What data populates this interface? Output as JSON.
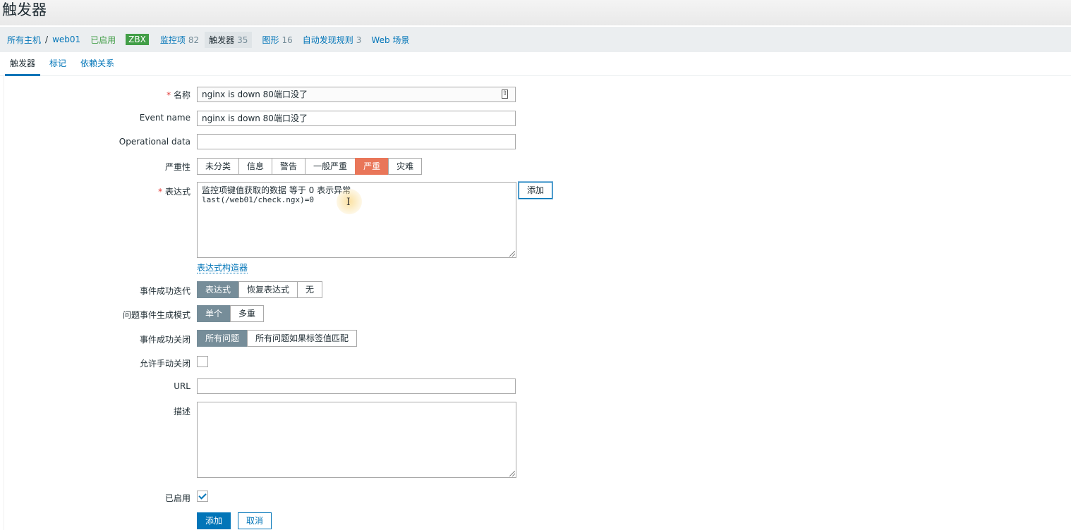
{
  "page": {
    "title": "触发器"
  },
  "breadcrumb": {
    "all_hosts": "所有主机",
    "separator": "/",
    "host": "web01",
    "status": "已启用",
    "zbx_badge": "ZBX",
    "items_label": "监控项",
    "items_count": "82",
    "triggers_label": "触发器",
    "triggers_count": "35",
    "graphs_label": "图形",
    "graphs_count": "16",
    "discovery_label": "自动发现规则",
    "discovery_count": "3",
    "web_label": "Web 场景"
  },
  "tabs": {
    "trigger": "触发器",
    "tags": "标记",
    "dependencies": "依赖关系"
  },
  "form": {
    "name_label": "名称",
    "name_value": "nginx is down 80端口没了",
    "event_name_label": "Event name",
    "event_name_value": "nginx is down 80端口没了",
    "opdata_label": "Operational data",
    "opdata_value": "",
    "severity_label": "严重性",
    "severity_options": [
      "未分类",
      "信息",
      "警告",
      "一般严重",
      "严重",
      "灾难"
    ],
    "severity_selected": "严重",
    "expression_label": "表达式",
    "expression_comment": "监控项键值获取的数据 等于 0 表示异常",
    "expression_code": "last(/web01/check.ngx)=0",
    "expression_add": "添加",
    "expression_builder": "表达式构造器",
    "ok_event_label": "事件成功迭代",
    "ok_event_options": [
      "表达式",
      "恢复表达式",
      "无"
    ],
    "ok_event_selected": "表达式",
    "problem_mode_label": "问题事件生成模式",
    "problem_mode_options": [
      "单个",
      "多重"
    ],
    "problem_mode_selected": "单个",
    "ok_close_label": "事件成功关闭",
    "ok_close_options": [
      "所有问题",
      "所有问题如果标签值匹配"
    ],
    "ok_close_selected": "所有问题",
    "manual_close_label": "允许手动关闭",
    "manual_close_checked": false,
    "url_label": "URL",
    "url_value": "",
    "description_label": "描述",
    "description_value": "",
    "enabled_label": "已启用",
    "enabled_checked": true,
    "submit": "添加",
    "cancel": "取消"
  },
  "colors": {
    "accent": "#0275b8",
    "severity_high": "#e97659",
    "segment_on": "#768d99",
    "enabled_green": "#429e47"
  }
}
